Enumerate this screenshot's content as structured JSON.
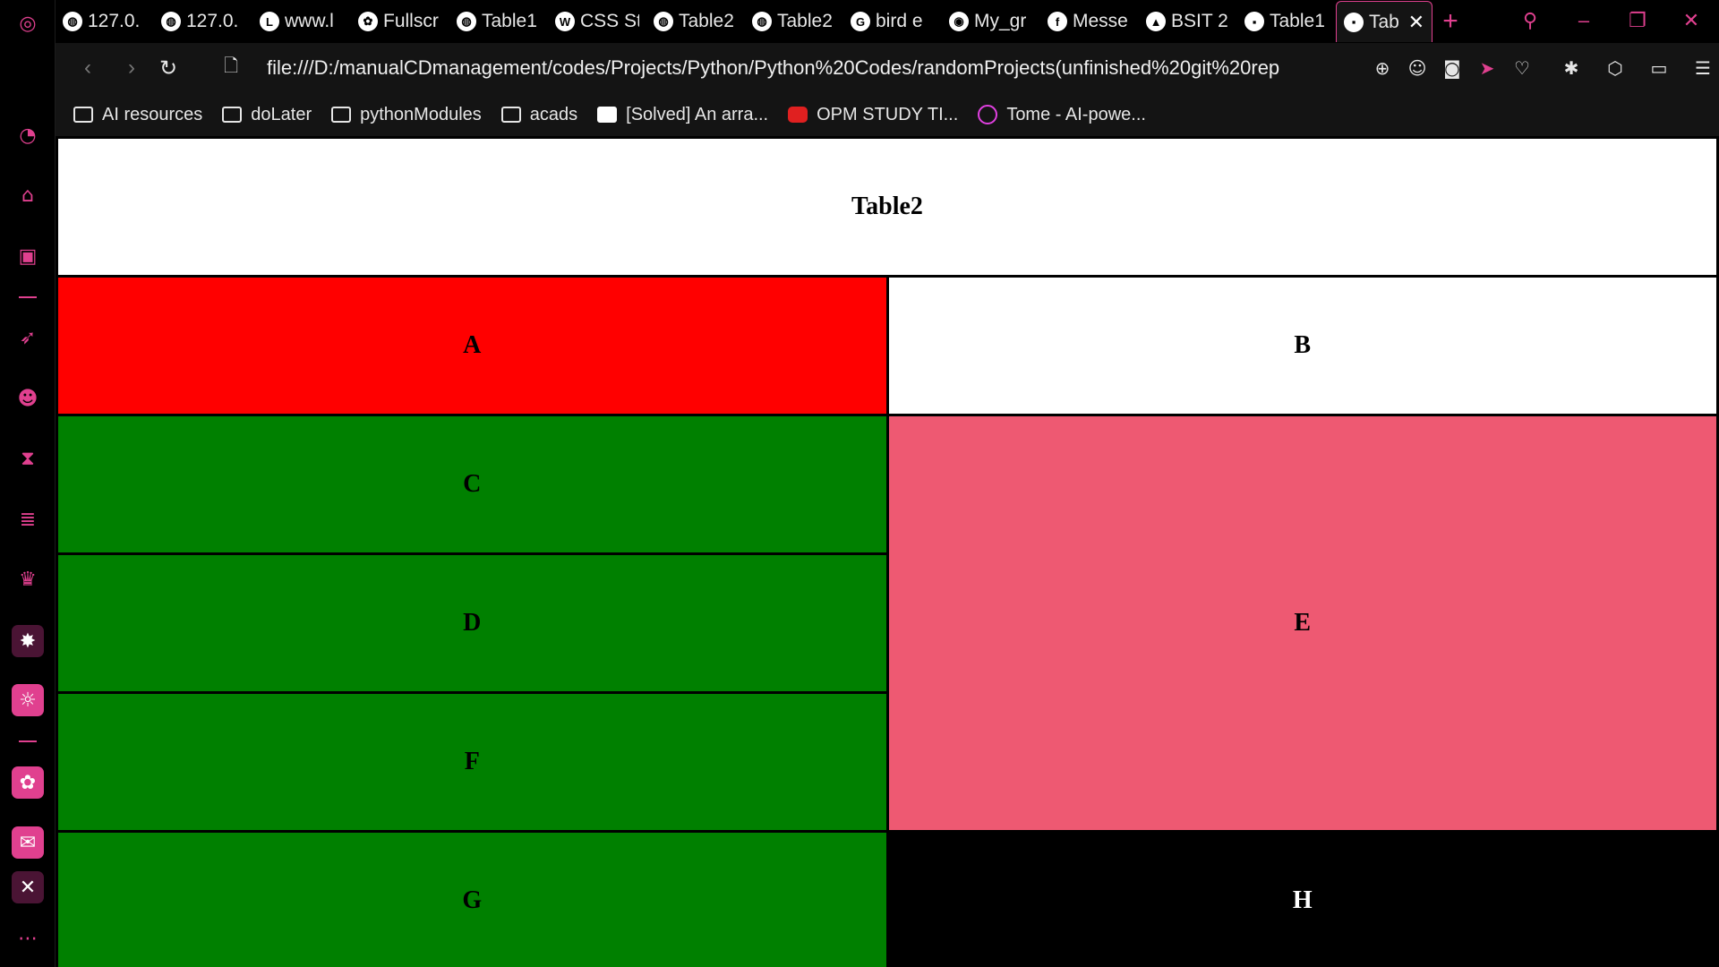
{
  "browser": {
    "tabs": [
      {
        "label": "127.0.",
        "icon": "globe-icon"
      },
      {
        "label": "127.0.",
        "icon": "globe-icon"
      },
      {
        "label": "www.l",
        "icon": "letter-l-icon"
      },
      {
        "label": "Fullscr",
        "icon": "chatgpt-icon"
      },
      {
        "label": "Table1",
        "icon": "globe-icon"
      },
      {
        "label": "CSS St",
        "icon": "w3schools-icon"
      },
      {
        "label": "Table2",
        "icon": "globe-icon"
      },
      {
        "label": "Table2",
        "icon": "globe-icon"
      },
      {
        "label": "bird e",
        "icon": "google-icon"
      },
      {
        "label": "My_gr",
        "icon": "github-icon"
      },
      {
        "label": "Messe",
        "icon": "facebook-icon"
      },
      {
        "label": "BSIT 2",
        "icon": "google-drive-icon"
      },
      {
        "label": "Table1",
        "icon": "image-thumbnail-icon"
      }
    ],
    "active_tab": {
      "label": "Tab",
      "icon": "image-thumbnail-icon"
    },
    "new_tab_label": "+",
    "url": "file:///D:/manualCDmanagement/codes/Projects/Python/Python%20Codes/randomProjects(unfinished%20git%20rep",
    "bookmarks": [
      {
        "label": "AI resources",
        "icon": "folder-icon"
      },
      {
        "label": "doLater",
        "icon": "folder-icon"
      },
      {
        "label": "pythonModules",
        "icon": "folder-icon"
      },
      {
        "label": "acads",
        "icon": "folder-icon"
      },
      {
        "label": "[Solved] An arra...",
        "icon": "mail-icon"
      },
      {
        "label": "OPM STUDY TI...",
        "icon": "youtube-icon"
      },
      {
        "label": "Tome - AI-powe...",
        "icon": "tome-icon"
      }
    ],
    "accent_color": "#e0408f"
  },
  "page": {
    "title": "Table2",
    "cells": {
      "a": "A",
      "b": "B",
      "c": "C",
      "d": "D",
      "e": "E",
      "f": "F",
      "g": "G",
      "h": "H"
    },
    "colors": {
      "title": "#ffffff",
      "a": "#ff0000",
      "b": "#ffffff",
      "cdfg": "#008000",
      "e": "#ee5972",
      "h": "#000000"
    }
  }
}
